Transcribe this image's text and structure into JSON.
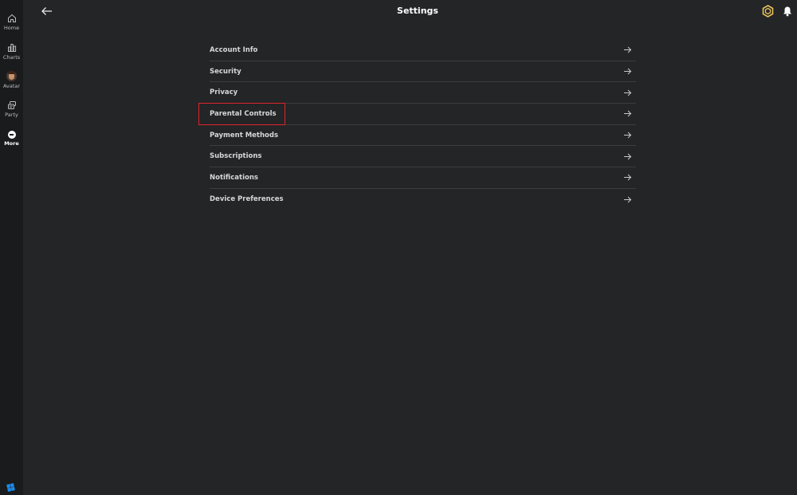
{
  "header": {
    "title": "Settings"
  },
  "nav": {
    "items": [
      {
        "label": "Home",
        "icon": "home-icon"
      },
      {
        "label": "Charts",
        "icon": "chart-icon"
      },
      {
        "label": "Avatar",
        "icon": "avatar-icon"
      },
      {
        "label": "Party",
        "icon": "party-icon"
      },
      {
        "label": "More",
        "icon": "more-icon"
      }
    ],
    "active": "More"
  },
  "settings": {
    "items": [
      {
        "label": "Account Info"
      },
      {
        "label": "Security"
      },
      {
        "label": "Privacy"
      },
      {
        "label": "Parental Controls"
      },
      {
        "label": "Payment Methods"
      },
      {
        "label": "Subscriptions"
      },
      {
        "label": "Notifications"
      },
      {
        "label": "Device Preferences"
      }
    ],
    "highlighted": "Parental Controls"
  },
  "colors": {
    "background": "#232527",
    "rail": "#191b1d",
    "divider": "#3b3d40",
    "highlight": "#e0232b",
    "robux_gold": "#e8c25a",
    "logo_blue": "#1e8ae8"
  }
}
